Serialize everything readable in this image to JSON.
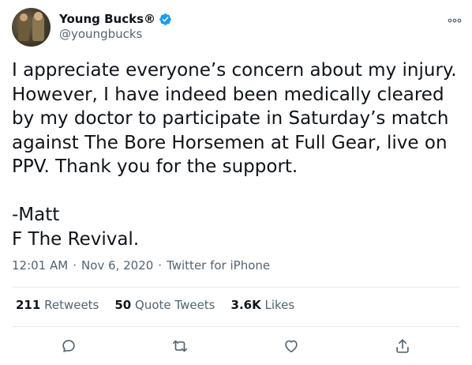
{
  "user": {
    "display_name": "Young Bucks®",
    "handle": "@youngbucks"
  },
  "tweet": {
    "text": "I appreciate everyone’s concern about my injury. However, I have indeed been medically cleared by my doctor to participate in Saturday’s match against The Bore Horsemen at Full Gear, live on PPV. Thank you for the support.\n\n-Matt\nF The Revival."
  },
  "meta": {
    "time": "12:01 AM",
    "date": "Nov 6, 2020",
    "source": "Twitter for iPhone",
    "separator": "·"
  },
  "stats": {
    "retweets_count": "211",
    "retweets_label": "Retweets",
    "quotes_count": "50",
    "quotes_label": "Quote Tweets",
    "likes_count": "3.6K",
    "likes_label": "Likes"
  },
  "icons": {
    "verified": "verified-badge-icon",
    "more": "more-icon",
    "reply": "reply-icon",
    "retweet": "retweet-icon",
    "like": "like-icon",
    "share": "share-icon"
  },
  "colors": {
    "accent": "#1d9bf0",
    "text": "#0f1419",
    "secondary": "#536471",
    "divider": "#e6ecf0"
  }
}
